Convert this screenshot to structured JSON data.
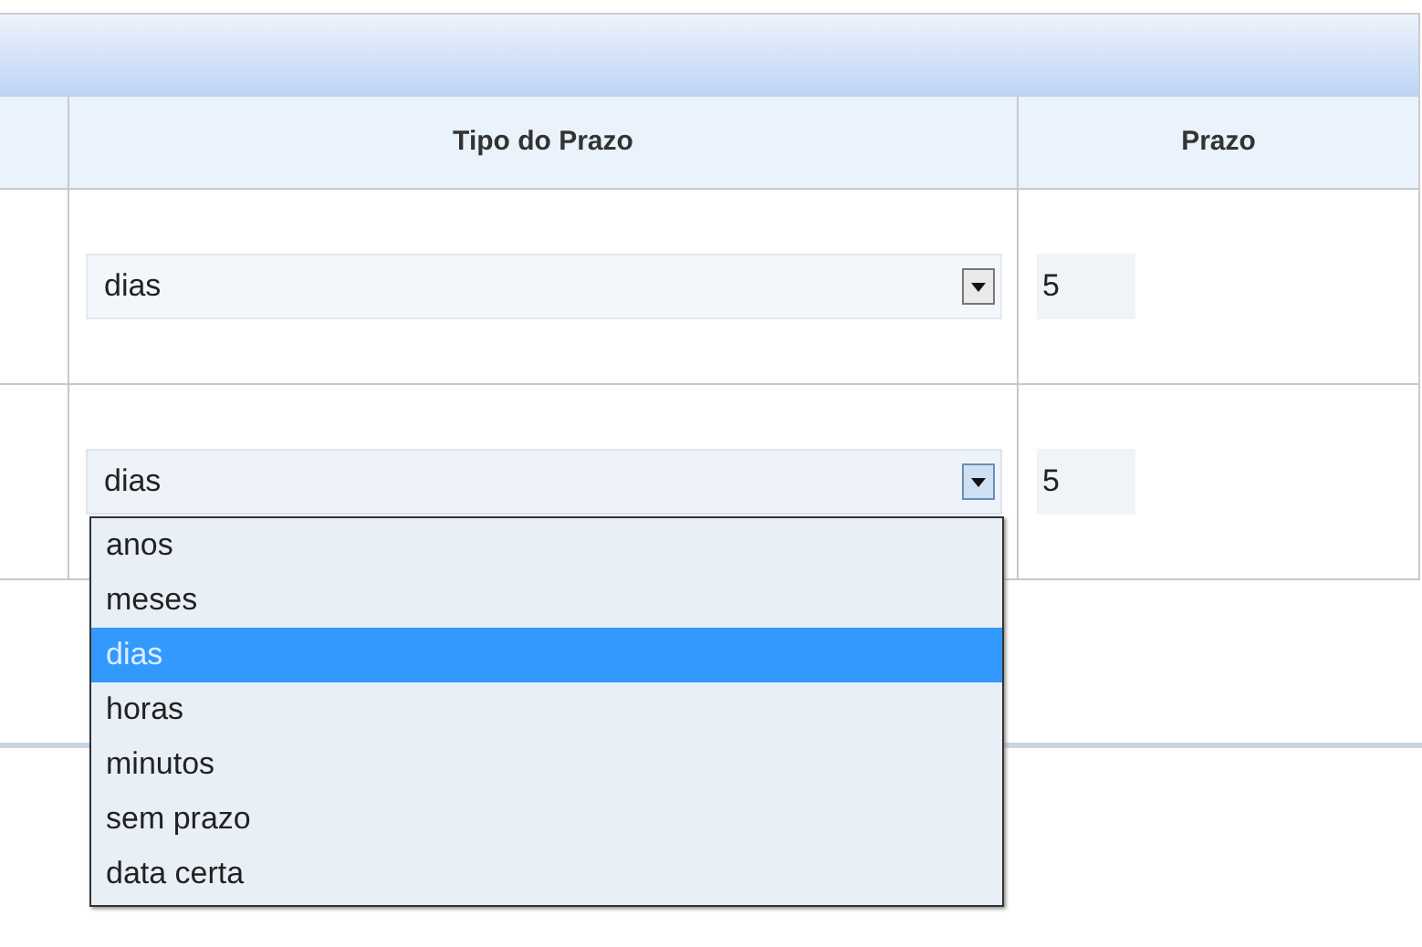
{
  "table": {
    "columns": [
      "Tipo do Prazo",
      "Prazo"
    ],
    "rows": [
      {
        "tipo": {
          "value": "dias",
          "expanded": false
        },
        "prazo": "5"
      },
      {
        "tipo": {
          "value": "dias",
          "expanded": true,
          "options": [
            {
              "label": "anos",
              "selected": false
            },
            {
              "label": "meses",
              "selected": false
            },
            {
              "label": "dias",
              "selected": true
            },
            {
              "label": "horas",
              "selected": false
            },
            {
              "label": "minutos",
              "selected": false
            },
            {
              "label": "sem prazo",
              "selected": false
            },
            {
              "label": "data certa",
              "selected": false
            }
          ]
        },
        "prazo": "5"
      }
    ]
  }
}
